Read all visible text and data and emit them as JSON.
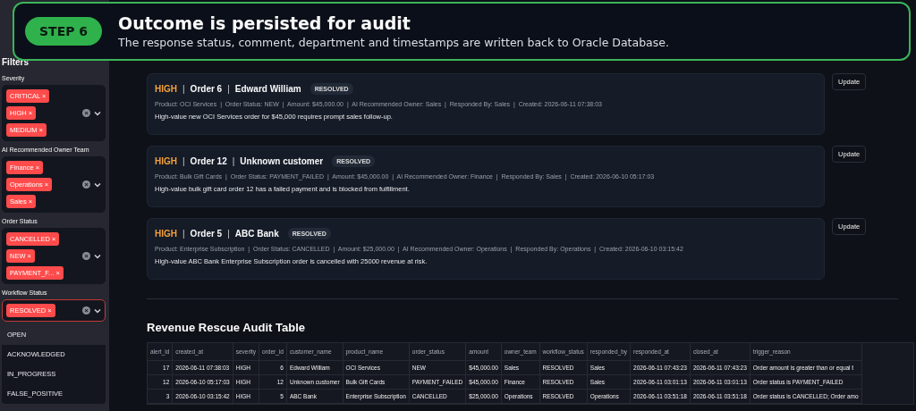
{
  "banner": {
    "step": "STEP 6",
    "title": "Outcome is persisted for audit",
    "subtitle": "The response status, comment, department and timestamps are written back to Oracle Database."
  },
  "sidebar": {
    "title": "Filters",
    "filters": [
      {
        "label": "Severity",
        "chips": [
          "CRITICAL",
          "HIGH",
          "MEDIUM"
        ],
        "focused": false
      },
      {
        "label": "AI Recommended Owner Team",
        "chips": [
          "Finance",
          "Operations",
          "Sales"
        ],
        "focused": false
      },
      {
        "label": "Order Status",
        "chips": [
          "CANCELLED",
          "NEW",
          "PAYMENT_F..."
        ],
        "focused": false
      },
      {
        "label": "Workflow Status",
        "chips": [
          "RESOLVED"
        ],
        "focused": true
      }
    ],
    "remove_mark": "×",
    "clear_mark": "×",
    "options": [
      {
        "label": "OPEN",
        "highlighted": true
      },
      {
        "label": "ACKNOWLEDGED",
        "highlighted": false
      },
      {
        "label": "IN_PROGRESS",
        "highlighted": false
      },
      {
        "label": "FALSE_POSITIVE",
        "highlighted": false
      }
    ]
  },
  "separator": "|",
  "actions": [
    {
      "severity": "HIGH",
      "color": "#f5a13a",
      "order": "Order 6",
      "customer": "Edward William",
      "badge": "RESOLVED",
      "meta": "Product: OCI Services  |  Order Status: NEW  |  Amount: $45,000.00  |  AI Recommended Owner: Sales  |  Responded By: Sales  |  Created: 2026-06-11 07:38:03",
      "summary": "High-value new OCI Services order for $45,000 requires prompt sales follow-up.",
      "button": "Update"
    },
    {
      "severity": "HIGH",
      "color": "#f5a13a",
      "order": "Order 12",
      "customer": "Unknown customer",
      "badge": "RESOLVED",
      "meta": "Product: Bulk Gift Cards  |  Order Status: PAYMENT_FAILED  |  Amount: $45,000.00  |  AI Recommended Owner: Finance  |  Responded By: Sales  |  Created: 2026-06-10 05:17:03",
      "summary": "High-value bulk gift card order 12 has a failed payment and is blocked from fulfillment.",
      "button": "Update"
    },
    {
      "severity": "HIGH",
      "color": "#f5a13a",
      "order": "Order 5",
      "customer": "ABC Bank",
      "badge": "RESOLVED",
      "meta": "Product: Enterprise Subscription  |  Order Status: CANCELLED  |  Amount: $25,000.00  |  AI Recommended Owner: Operations  |  Responded By: Operations  |  Created: 2026-06-10 03:15:42",
      "summary": "High-value ABC Bank Enterprise Subscription order is cancelled with 25000 revenue at risk.",
      "button": "Update"
    }
  ],
  "table": {
    "title": "Revenue Rescue Audit Table",
    "columns": [
      {
        "label": "alert_id",
        "numeric": true
      },
      {
        "label": "created_at"
      },
      {
        "label": "severity"
      },
      {
        "label": "order_id",
        "numeric": true
      },
      {
        "label": "customer_name"
      },
      {
        "label": "product_name"
      },
      {
        "label": "order_status"
      },
      {
        "label": "amount"
      },
      {
        "label": "owner_team"
      },
      {
        "label": "workflow_status"
      },
      {
        "label": "responded_by"
      },
      {
        "label": "responded_at"
      },
      {
        "label": "closed_at"
      },
      {
        "label": "trigger_reason"
      }
    ],
    "rows": [
      [
        "17",
        "2026-06-11 07:38:03",
        "HIGH",
        "6",
        "Edward William",
        "OCI Services",
        "NEW",
        "$45,000.00",
        "Sales",
        "RESOLVED",
        "Sales",
        "2026-06-11 07:43:23",
        "2026-06-11 07:43:23",
        "Order amount is greater than or equal t"
      ],
      [
        "12",
        "2026-06-10 05:17:03",
        "HIGH",
        "12",
        "Unknown customer",
        "Bulk Gift Cards",
        "PAYMENT_FAILED",
        "$45,000.00",
        "Finance",
        "RESOLVED",
        "Sales",
        "2026-06-11 03:01:13",
        "2026-06-11 03:01:13",
        "Order status is PAYMENT_FAILED"
      ],
      [
        "3",
        "2026-06-10 03:15:42",
        "HIGH",
        "5",
        "ABC Bank",
        "Enterprise Subscription",
        "CANCELLED",
        "$25,000.00",
        "Operations",
        "RESOLVED",
        "Operations",
        "2026-06-11 03:51:18",
        "2026-06-11 03:51:18",
        "Order status is CANCELLED; Order amo"
      ]
    ]
  }
}
